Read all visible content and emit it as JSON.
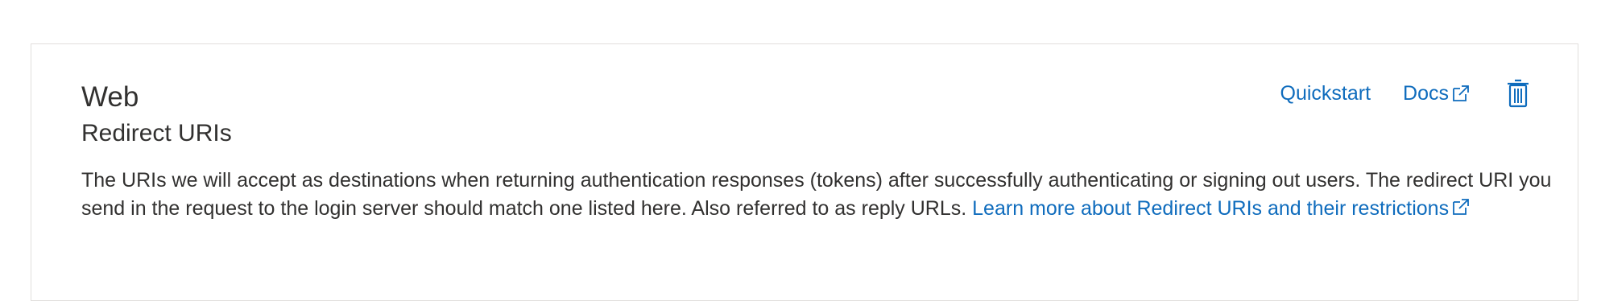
{
  "section": {
    "title": "Web",
    "subtitle": "Redirect URIs",
    "description": "The URIs we will accept as destinations when returning authentication responses (tokens) after successfully authenticating or signing out users. The redirect URI you send in the request to the login server should match one listed here. Also referred to as reply URLs. ",
    "learn_more_link": "Learn more about Redirect URIs and their restrictions"
  },
  "actions": {
    "quickstart_label": "Quickstart",
    "docs_label": "Docs",
    "delete_icon": "trash-icon"
  },
  "colors": {
    "link": "#0f6cbd",
    "text": "#323130",
    "border": "#e1dfdd"
  }
}
